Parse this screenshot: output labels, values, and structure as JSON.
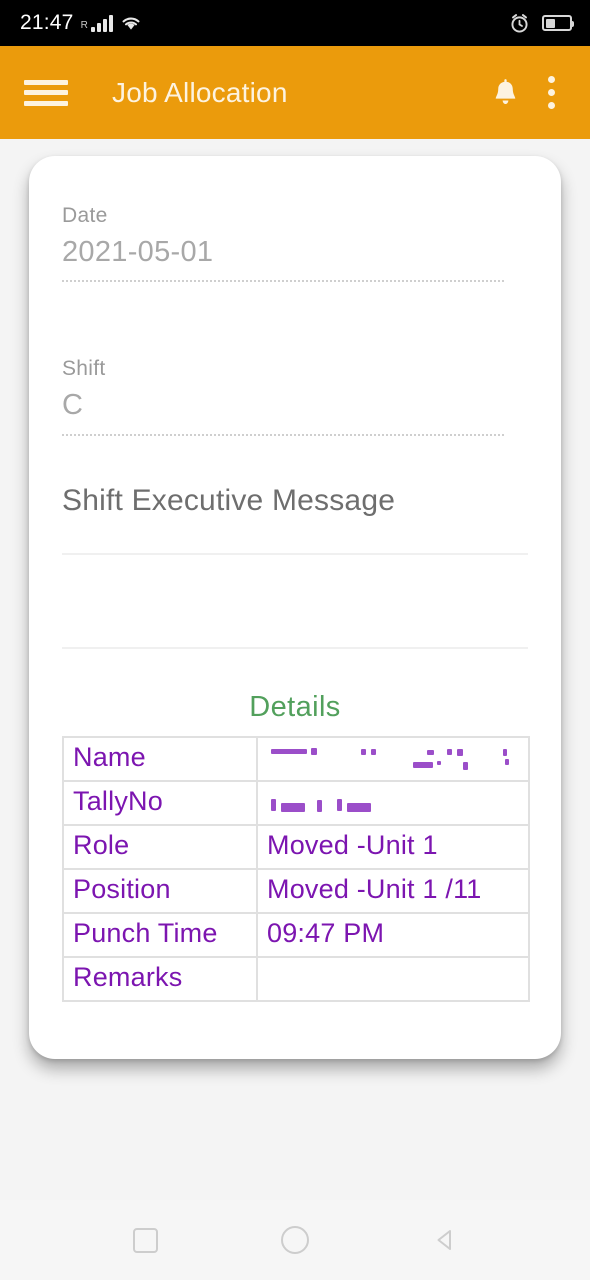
{
  "status_bar": {
    "time": "21:47",
    "roaming_indicator": "R",
    "signal_icon": "signal-bars-icon",
    "wifi_icon": "wifi-icon",
    "alarm_icon": "alarm-clock-icon",
    "battery_icon": "battery-icon",
    "battery_level_percent": 42
  },
  "app_bar": {
    "menu_icon": "hamburger-menu-icon",
    "title": "Job Allocation",
    "notification_icon": "bell-icon",
    "overflow_icon": "more-vertical-icon",
    "background_color": "#eb9b0c",
    "text_color": "#fdf3e0"
  },
  "form": {
    "date": {
      "label": "Date",
      "value": "2021-05-01"
    },
    "shift": {
      "label": "Shift",
      "value": "C"
    },
    "message": {
      "heading": "Shift Executive Message",
      "value": ""
    }
  },
  "details": {
    "title": "Details",
    "title_color": "#52a05c",
    "text_color": "#7c15b0",
    "rows": [
      {
        "key": "Name",
        "value": "",
        "redacted": true
      },
      {
        "key": "TallyNo",
        "value": "",
        "redacted": true
      },
      {
        "key": "Role",
        "value": "Moved -Unit 1",
        "redacted": false
      },
      {
        "key": "Position",
        "value": "Moved -Unit 1 /11",
        "redacted": false
      },
      {
        "key": "Punch Time",
        "value": "09:47 PM",
        "redacted": false
      },
      {
        "key": "Remarks",
        "value": "",
        "redacted": false
      }
    ]
  },
  "nav_bar": {
    "recents_icon": "square-recents-icon",
    "home_icon": "circle-home-icon",
    "back_icon": "triangle-back-icon"
  }
}
